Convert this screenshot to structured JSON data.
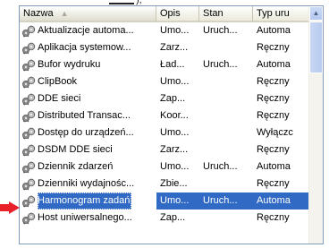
{
  "columns": [
    {
      "label": "Nazwa",
      "sort_glyph": "▲"
    },
    {
      "label": "Opis"
    },
    {
      "label": "Stan"
    },
    {
      "label": "Typ uru"
    }
  ],
  "rows": [
    {
      "name": "Aktualizacje automa...",
      "opis": "Umo...",
      "stan": "Uruch...",
      "typ": "Automa"
    },
    {
      "name": "Aplikacja systemow...",
      "opis": "Zarz...",
      "stan": "",
      "typ": "Ręczny"
    },
    {
      "name": "Bufor wydruku",
      "opis": "Ład...",
      "stan": "Uruch...",
      "typ": "Automa"
    },
    {
      "name": "ClipBook",
      "opis": "Umo...",
      "stan": "",
      "typ": "Ręczny"
    },
    {
      "name": "DDE sieci",
      "opis": "Zap...",
      "stan": "",
      "typ": "Ręczny"
    },
    {
      "name": "Distributed Transac...",
      "opis": "Koor...",
      "stan": "",
      "typ": "Ręczny"
    },
    {
      "name": "Dostęp do urządzeń...",
      "opis": "Umo...",
      "stan": "",
      "typ": "Wyłączc"
    },
    {
      "name": "DSDM DDE sieci",
      "opis": "Zarz...",
      "stan": "",
      "typ": "Ręczny"
    },
    {
      "name": "Dziennik zdarzeń",
      "opis": "Umo...",
      "stan": "Uruch...",
      "typ": "Automa"
    },
    {
      "name": "Dzienniki wydajnośc...",
      "opis": "Zbie...",
      "stan": "",
      "typ": "Ręczny"
    },
    {
      "name": "Harmonogram zadań",
      "opis": "Umo...",
      "stan": "Uruch...",
      "typ": "Automa",
      "selected": true
    },
    {
      "name": "Host uniwersalnego...",
      "opis": "Zap...",
      "stan": "",
      "typ": "Ręczny"
    }
  ],
  "colors": {
    "selection": "#316ac5",
    "pointer_arrow": "#e8202a"
  }
}
